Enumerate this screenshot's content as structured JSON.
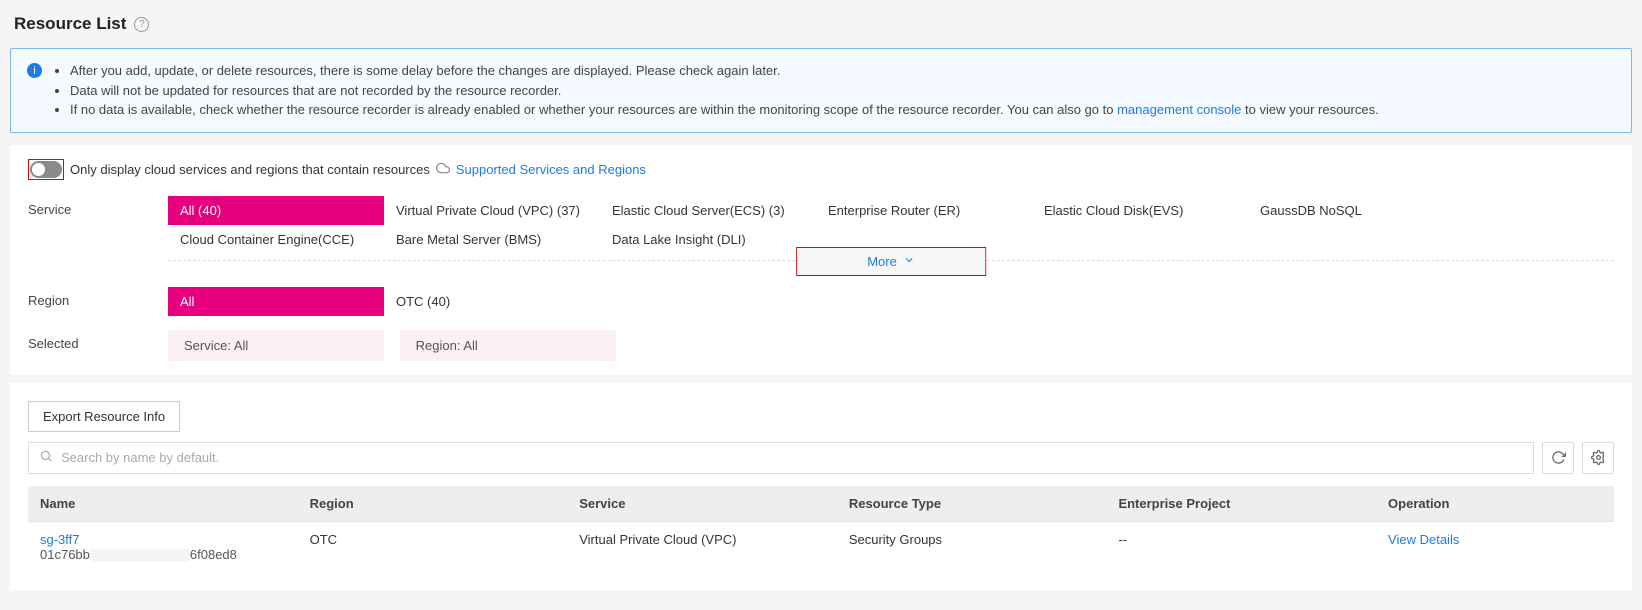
{
  "title": "Resource List",
  "info": {
    "line1": "After you add, update, or delete resources, there is some delay before the changes are displayed. Please check again later.",
    "line2": "Data will not be updated for resources that are not recorded by the resource recorder.",
    "line3_pre": "If no data is available, check whether the resource recorder is already enabled or whether your resources are within the monitoring scope of the resource recorder. You can also go to ",
    "line3_link": "management console",
    "line3_post": " to view your resources."
  },
  "toggle_label": "Only display cloud services and regions that contain resources",
  "supported_link": "Supported Services and Regions",
  "filters": {
    "service_label": "Service",
    "region_label": "Region",
    "selected_label": "Selected",
    "all_service": "All (40)",
    "services": [
      "Virtual Private Cloud (VPC) (37)",
      "Elastic Cloud Server(ECS) (3)",
      "Enterprise Router (ER)",
      "Elastic Cloud Disk(EVS)",
      "GaussDB NoSQL",
      "Cloud Container Engine(CCE)",
      "Bare Metal Server (BMS)",
      "Data Lake Insight (DLI)"
    ],
    "more": "More",
    "all_region": "All",
    "regions": [
      "OTC (40)"
    ],
    "selected_service": "Service: All",
    "selected_region": "Region: All"
  },
  "export_btn": "Export Resource Info",
  "search_placeholder": "Search by name by default.",
  "table": {
    "headers": {
      "name": "Name",
      "region": "Region",
      "service": "Service",
      "type": "Resource Type",
      "project": "Enterprise Project",
      "operation": "Operation"
    },
    "rows": [
      {
        "name": "sg-3ff7",
        "id_pre": "01c76bb",
        "id_post": "6f08ed8",
        "region": "OTC",
        "service": "Virtual Private Cloud (VPC)",
        "type": "Security Groups",
        "project": "--",
        "op": "View Details"
      }
    ]
  }
}
